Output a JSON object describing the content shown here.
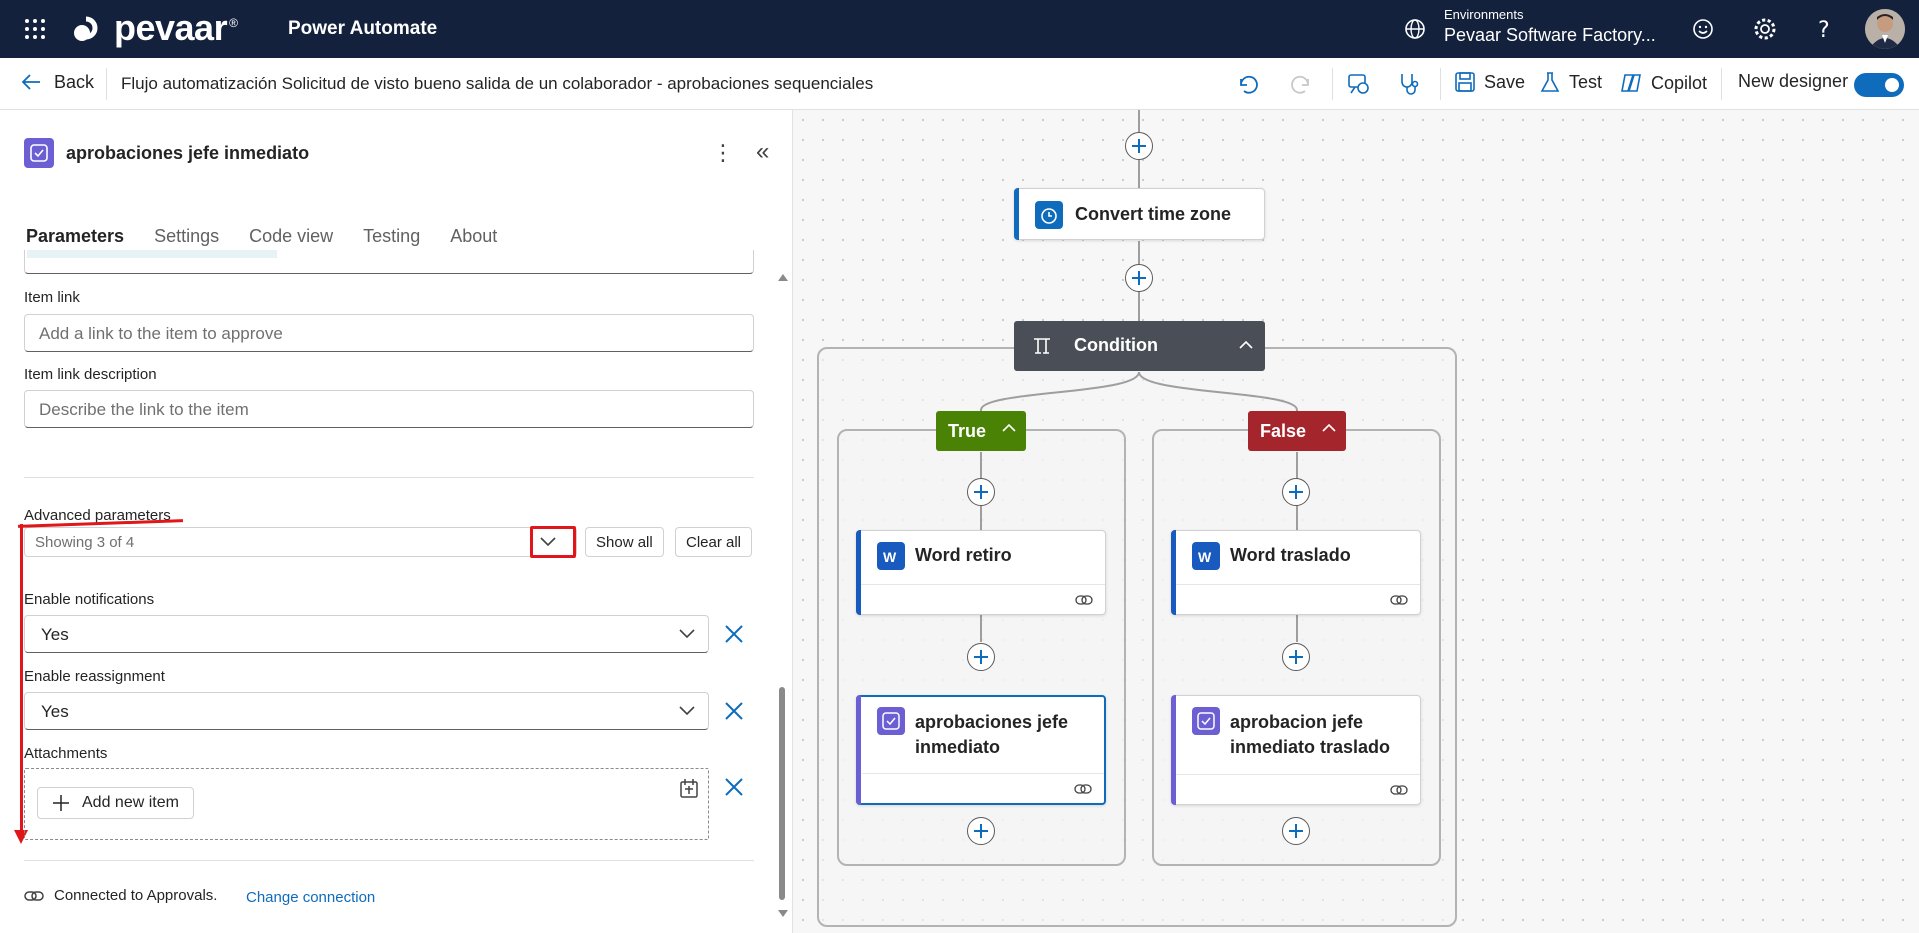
{
  "header": {
    "brand": "pevaar",
    "brand_mark": "®",
    "app_name": "Power Automate",
    "environment_label": "Environments",
    "environment_value": "Pevaar Software Factory..."
  },
  "commandbar": {
    "back_label": "Back",
    "flow_title": "Flujo automatización Solicitud de visto bueno salida de un colaborador - aprobaciones sequenciales",
    "save_label": "Save",
    "test_label": "Test",
    "copilot_label": "Copilot",
    "new_designer_label": "New designer",
    "new_designer_on": true
  },
  "panel": {
    "title": "aprobaciones jefe inmediato",
    "tabs": [
      {
        "label": "Parameters",
        "active": true
      },
      {
        "label": "Settings",
        "active": false
      },
      {
        "label": "Code view",
        "active": false
      },
      {
        "label": "Testing",
        "active": false
      },
      {
        "label": "About",
        "active": false
      }
    ],
    "item_link": {
      "label": "Item link",
      "placeholder": "Add a link to the item to approve"
    },
    "item_link_description": {
      "label": "Item link description",
      "placeholder": "Describe the link to the item"
    },
    "advanced": {
      "label": "Advanced parameters",
      "showing": "Showing 3 of 4",
      "show_all": "Show all",
      "clear_all": "Clear all"
    },
    "enable_notifications": {
      "label": "Enable notifications",
      "value": "Yes"
    },
    "enable_reassignment": {
      "label": "Enable reassignment",
      "value": "Yes"
    },
    "attachments": {
      "label": "Attachments",
      "add_label": "Add new item"
    },
    "connection": {
      "text": "Connected to Approvals.",
      "change_label": "Change connection"
    }
  },
  "canvas": {
    "convert_time_zone": "Convert time zone",
    "condition": "Condition",
    "true_label": "True",
    "false_label": "False",
    "true_branch": [
      "Word retiro",
      "aprobaciones jefe inmediato"
    ],
    "false_branch": [
      "Word traslado",
      "aprobacion jefe inmediato traslado"
    ]
  },
  "colors": {
    "topbar": "#13213d",
    "accent": "#0f6cbd",
    "true_badge": "#498205",
    "false_badge": "#a4262c",
    "condition": "#4a4f57",
    "approval": "#6b5fd3",
    "word": "#185abd",
    "annotation": "#e0161a"
  }
}
